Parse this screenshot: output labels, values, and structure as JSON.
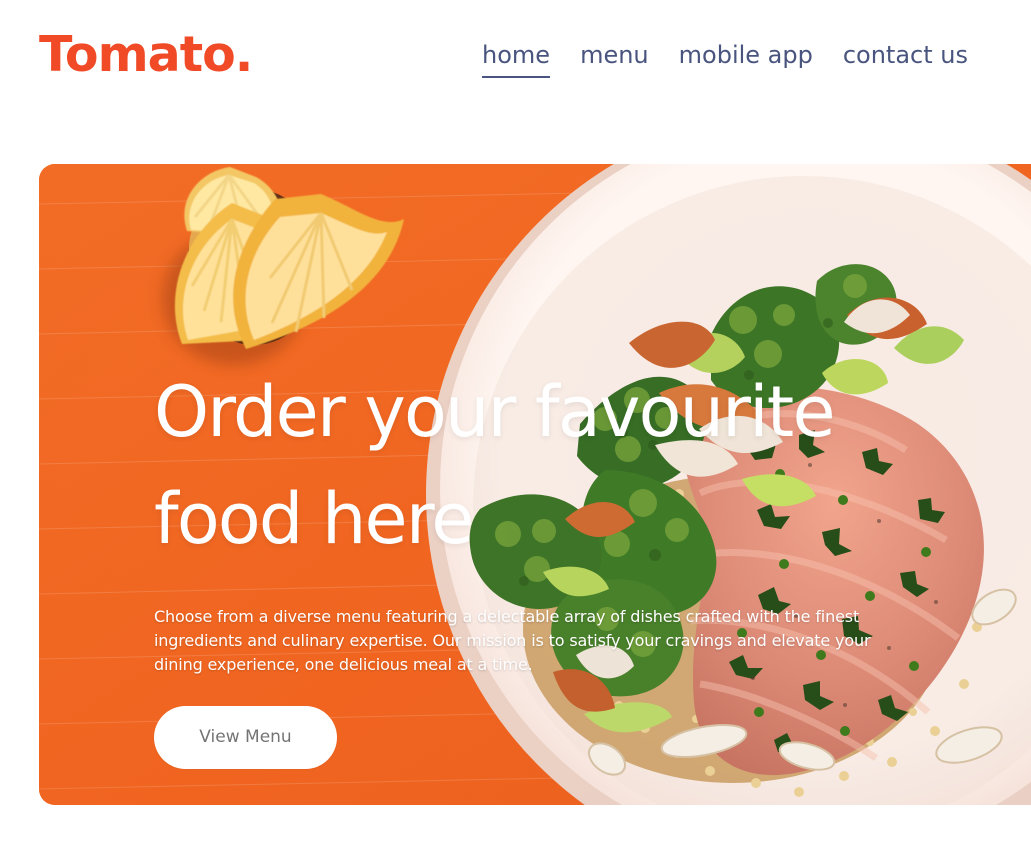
{
  "brand": {
    "name": "Tomato."
  },
  "navigation": {
    "items": [
      {
        "label": "home",
        "active": true
      },
      {
        "label": "menu",
        "active": false
      },
      {
        "label": "mobile app",
        "active": false
      },
      {
        "label": "contact us",
        "active": false
      }
    ]
  },
  "hero": {
    "title": "Order your favourite food here",
    "description": "Choose from a diverse menu featuring a delectable array of dishes crafted with the finest ingredients and culinary expertise. Our mission is to satisfy your cravings and elevate your dining experience, one delicious meal at a time.",
    "button_label": "View Menu",
    "image_subject": "plated salmon with broccoli, quinoa and lemon"
  },
  "colors": {
    "brand": "#f04a27",
    "nav_text": "#49557e",
    "hero_background": "#f26a24",
    "button_text": "#747474",
    "white": "#ffffff"
  }
}
